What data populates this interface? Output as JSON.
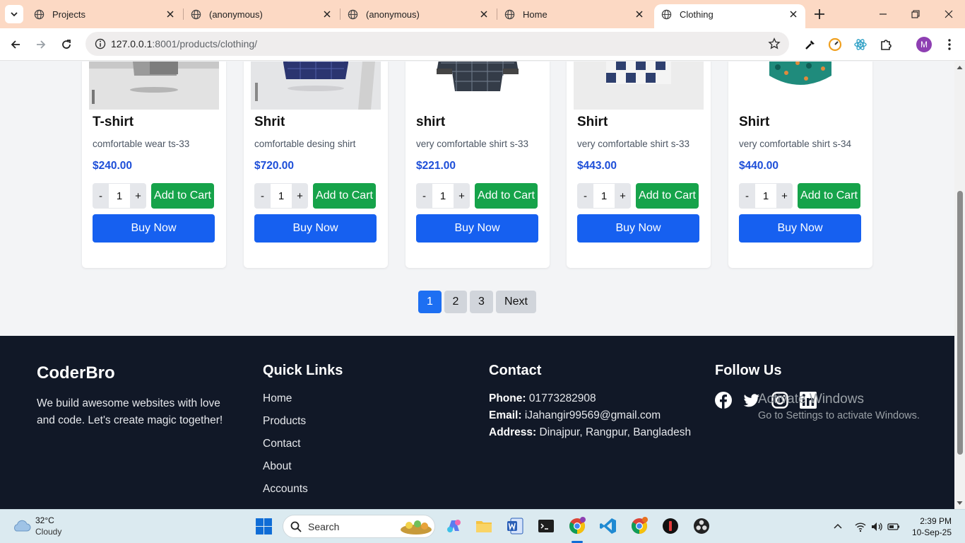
{
  "browser": {
    "tabs": [
      {
        "title": "Projects",
        "active": false
      },
      {
        "title": "(anonymous)",
        "active": false
      },
      {
        "title": "(anonymous)",
        "active": false
      },
      {
        "title": "Home",
        "active": false
      },
      {
        "title": "Clothing",
        "active": true
      }
    ],
    "url_host": "127.0.0.1",
    "url_path": ":8001/products/clothing/",
    "profile_initial": "M"
  },
  "products": [
    {
      "name": "T-shirt",
      "desc": "comfortable wear ts-33",
      "price": "$240.00",
      "qty": "1"
    },
    {
      "name": "Shrit",
      "desc": "comfortable desing shirt",
      "price": "$720.00",
      "qty": "1"
    },
    {
      "name": "shirt",
      "desc": "very comfortable shirt s-33",
      "price": "$221.00",
      "qty": "1"
    },
    {
      "name": "Shirt",
      "desc": "very comfortable shirt s-33",
      "price": "$443.00",
      "qty": "1"
    },
    {
      "name": "Shirt",
      "desc": "very comfortable shirt s-34",
      "price": "$440.00",
      "qty": "1"
    }
  ],
  "buttons": {
    "minus": "-",
    "plus": "+",
    "add_to_cart": "Add to Cart",
    "buy_now": "Buy Now"
  },
  "pagination": [
    "1",
    "2",
    "3",
    "Next"
  ],
  "pagination_active": "1",
  "footer": {
    "brand": "CoderBro",
    "tagline": "We build awesome websites with love and code. Let's create magic together!",
    "quick_links_title": "Quick Links",
    "quick_links": [
      "Home",
      "Products",
      "Contact",
      "About",
      "Accounts"
    ],
    "contact_title": "Contact",
    "phone_label": "Phone:",
    "phone": "01773282908",
    "email_label": "Email:",
    "email": "iJahangir99569@gmail.com",
    "address_label": "Address:",
    "address": "Dinajpur, Rangpur, Bangladesh",
    "follow_title": "Follow Us",
    "social": [
      "facebook-icon",
      "twitter-icon",
      "instagram-icon",
      "linkedin-icon"
    ]
  },
  "watermark": {
    "line1": "Activate Windows",
    "line2": "Go to Settings to activate Windows."
  },
  "taskbar": {
    "temp": "32°C",
    "condition": "Cloudy",
    "search_placeholder": "Search",
    "time": "2:39 PM",
    "date": "10-Sep-25"
  },
  "colors": {
    "add_to_cart": "#16a34a",
    "buy_now": "#1660f0",
    "price": "#1d4ed8",
    "footer_bg": "#111827",
    "tab_strip": "#fcd9c4"
  }
}
